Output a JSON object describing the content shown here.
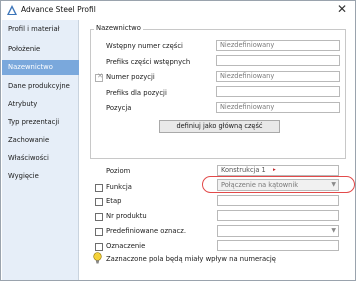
{
  "window": {
    "title": "Advance Steel   Profil",
    "close_glyph": "✕"
  },
  "sidebar": {
    "items": [
      {
        "label": "Profil i materiał"
      },
      {
        "label": "Położenie"
      },
      {
        "label": "Nazewnictwo",
        "active": true
      },
      {
        "label": "Dane produkcyjne"
      },
      {
        "label": "Atrybuty"
      },
      {
        "label": "Typ prezentacji"
      },
      {
        "label": "Zachowanie"
      },
      {
        "label": "Właściwości"
      },
      {
        "label": "Wygięcie"
      }
    ]
  },
  "naming_group": {
    "legend": "Nazewnictwo",
    "rows": [
      {
        "label": "Wstępny numer części",
        "value": "Niezdefiniowany"
      },
      {
        "label": "Prefiks części wstępnych",
        "value": ""
      },
      {
        "label": "Numer pozycji",
        "value": "Niezdefiniowany"
      },
      {
        "label": "Prefiks dla pozycji",
        "value": ""
      },
      {
        "label": "Pozycja",
        "value": "Niezdefiniowany"
      }
    ],
    "define_button": "definiuj jako główną część"
  },
  "lower": {
    "rows": [
      {
        "label": "Poziom",
        "value": "Konstrukcja 1"
      },
      {
        "label": "Funkcja",
        "value": "Połączenie na kątownik"
      },
      {
        "label": "Etap",
        "value": ""
      },
      {
        "label": "Nr produktu",
        "value": ""
      },
      {
        "label": "Predefiniowane oznacz.",
        "value": ""
      },
      {
        "label": "Oznaczenie",
        "value": ""
      }
    ],
    "info_note": "Zaznaczone pola będą miały wpływ na numerację"
  },
  "colors": {
    "accent": "#7aa8dc",
    "highlight": "#e24a4a",
    "sidebar_bg": "#e6eef8"
  },
  "icons": {
    "app": "advance-steel-logo",
    "close": "close-icon",
    "info": "lightbulb-icon",
    "level_marker": "red-triangle-icon"
  }
}
